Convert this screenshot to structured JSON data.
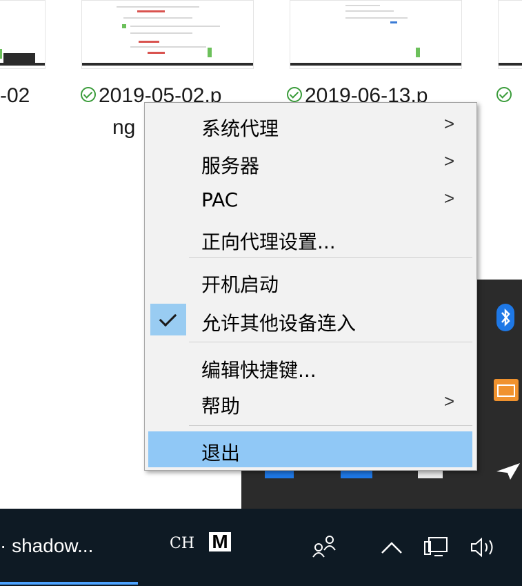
{
  "files": [
    {
      "name_line1": "-02",
      "name_line2": ""
    },
    {
      "name_line1": "2019-05-02.p",
      "name_line2": "ng"
    },
    {
      "name_line1": "2019-06-13.p",
      "name_line2": ""
    }
  ],
  "context_menu": {
    "items": [
      {
        "label": "系统代理",
        "submenu": true
      },
      {
        "label": "服务器",
        "submenu": true
      },
      {
        "label": "PAC",
        "submenu": true
      },
      {
        "label": "正向代理设置...",
        "submenu": false
      },
      {
        "label": "开机启动",
        "submenu": false
      },
      {
        "label": "允许其他设备连入",
        "submenu": false,
        "checked": true
      },
      {
        "label": "编辑快捷键...",
        "submenu": false
      },
      {
        "label": "帮助",
        "submenu": true
      },
      {
        "label": "退出",
        "submenu": false,
        "highlighted": true
      }
    ],
    "arrow_glyph": ">",
    "check_glyph": "✓"
  },
  "taskbar": {
    "app_label": "· shadow...",
    "ime_lang": "CH",
    "ime_mode": "M"
  },
  "colors": {
    "menu_bg": "#f2f2f2",
    "menu_highlight": "#90c8f6",
    "check_bg": "#99ccf2",
    "taskbar_bg": "#0e1a24",
    "tray_popup_bg": "#2b2b2b",
    "sync_green": "#3a9c3a",
    "bluetooth_blue": "#1e78e6",
    "app_orange": "#f0922e"
  },
  "icons": [
    "sync-status-icon",
    "bluetooth-icon",
    "window-app-icon",
    "paper-plane-icon",
    "people-icon",
    "chevron-up-icon",
    "network-icon",
    "volume-icon"
  ]
}
